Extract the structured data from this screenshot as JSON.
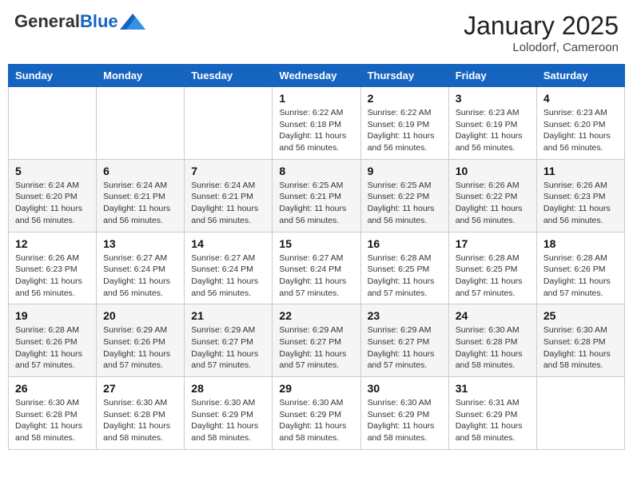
{
  "header": {
    "logo_general": "General",
    "logo_blue": "Blue",
    "month_year": "January 2025",
    "location": "Lolodorf, Cameroon"
  },
  "weekdays": [
    "Sunday",
    "Monday",
    "Tuesday",
    "Wednesday",
    "Thursday",
    "Friday",
    "Saturday"
  ],
  "weeks": [
    [
      {
        "day": "",
        "info": ""
      },
      {
        "day": "",
        "info": ""
      },
      {
        "day": "",
        "info": ""
      },
      {
        "day": "1",
        "info": "Sunrise: 6:22 AM\nSunset: 6:18 PM\nDaylight: 11 hours\nand 56 minutes."
      },
      {
        "day": "2",
        "info": "Sunrise: 6:22 AM\nSunset: 6:19 PM\nDaylight: 11 hours\nand 56 minutes."
      },
      {
        "day": "3",
        "info": "Sunrise: 6:23 AM\nSunset: 6:19 PM\nDaylight: 11 hours\nand 56 minutes."
      },
      {
        "day": "4",
        "info": "Sunrise: 6:23 AM\nSunset: 6:20 PM\nDaylight: 11 hours\nand 56 minutes."
      }
    ],
    [
      {
        "day": "5",
        "info": "Sunrise: 6:24 AM\nSunset: 6:20 PM\nDaylight: 11 hours\nand 56 minutes."
      },
      {
        "day": "6",
        "info": "Sunrise: 6:24 AM\nSunset: 6:21 PM\nDaylight: 11 hours\nand 56 minutes."
      },
      {
        "day": "7",
        "info": "Sunrise: 6:24 AM\nSunset: 6:21 PM\nDaylight: 11 hours\nand 56 minutes."
      },
      {
        "day": "8",
        "info": "Sunrise: 6:25 AM\nSunset: 6:21 PM\nDaylight: 11 hours\nand 56 minutes."
      },
      {
        "day": "9",
        "info": "Sunrise: 6:25 AM\nSunset: 6:22 PM\nDaylight: 11 hours\nand 56 minutes."
      },
      {
        "day": "10",
        "info": "Sunrise: 6:26 AM\nSunset: 6:22 PM\nDaylight: 11 hours\nand 56 minutes."
      },
      {
        "day": "11",
        "info": "Sunrise: 6:26 AM\nSunset: 6:23 PM\nDaylight: 11 hours\nand 56 minutes."
      }
    ],
    [
      {
        "day": "12",
        "info": "Sunrise: 6:26 AM\nSunset: 6:23 PM\nDaylight: 11 hours\nand 56 minutes."
      },
      {
        "day": "13",
        "info": "Sunrise: 6:27 AM\nSunset: 6:24 PM\nDaylight: 11 hours\nand 56 minutes."
      },
      {
        "day": "14",
        "info": "Sunrise: 6:27 AM\nSunset: 6:24 PM\nDaylight: 11 hours\nand 56 minutes."
      },
      {
        "day": "15",
        "info": "Sunrise: 6:27 AM\nSunset: 6:24 PM\nDaylight: 11 hours\nand 57 minutes."
      },
      {
        "day": "16",
        "info": "Sunrise: 6:28 AM\nSunset: 6:25 PM\nDaylight: 11 hours\nand 57 minutes."
      },
      {
        "day": "17",
        "info": "Sunrise: 6:28 AM\nSunset: 6:25 PM\nDaylight: 11 hours\nand 57 minutes."
      },
      {
        "day": "18",
        "info": "Sunrise: 6:28 AM\nSunset: 6:26 PM\nDaylight: 11 hours\nand 57 minutes."
      }
    ],
    [
      {
        "day": "19",
        "info": "Sunrise: 6:28 AM\nSunset: 6:26 PM\nDaylight: 11 hours\nand 57 minutes."
      },
      {
        "day": "20",
        "info": "Sunrise: 6:29 AM\nSunset: 6:26 PM\nDaylight: 11 hours\nand 57 minutes."
      },
      {
        "day": "21",
        "info": "Sunrise: 6:29 AM\nSunset: 6:27 PM\nDaylight: 11 hours\nand 57 minutes."
      },
      {
        "day": "22",
        "info": "Sunrise: 6:29 AM\nSunset: 6:27 PM\nDaylight: 11 hours\nand 57 minutes."
      },
      {
        "day": "23",
        "info": "Sunrise: 6:29 AM\nSunset: 6:27 PM\nDaylight: 11 hours\nand 57 minutes."
      },
      {
        "day": "24",
        "info": "Sunrise: 6:30 AM\nSunset: 6:28 PM\nDaylight: 11 hours\nand 58 minutes."
      },
      {
        "day": "25",
        "info": "Sunrise: 6:30 AM\nSunset: 6:28 PM\nDaylight: 11 hours\nand 58 minutes."
      }
    ],
    [
      {
        "day": "26",
        "info": "Sunrise: 6:30 AM\nSunset: 6:28 PM\nDaylight: 11 hours\nand 58 minutes."
      },
      {
        "day": "27",
        "info": "Sunrise: 6:30 AM\nSunset: 6:28 PM\nDaylight: 11 hours\nand 58 minutes."
      },
      {
        "day": "28",
        "info": "Sunrise: 6:30 AM\nSunset: 6:29 PM\nDaylight: 11 hours\nand 58 minutes."
      },
      {
        "day": "29",
        "info": "Sunrise: 6:30 AM\nSunset: 6:29 PM\nDaylight: 11 hours\nand 58 minutes."
      },
      {
        "day": "30",
        "info": "Sunrise: 6:30 AM\nSunset: 6:29 PM\nDaylight: 11 hours\nand 58 minutes."
      },
      {
        "day": "31",
        "info": "Sunrise: 6:31 AM\nSunset: 6:29 PM\nDaylight: 11 hours\nand 58 minutes."
      },
      {
        "day": "",
        "info": ""
      }
    ]
  ]
}
